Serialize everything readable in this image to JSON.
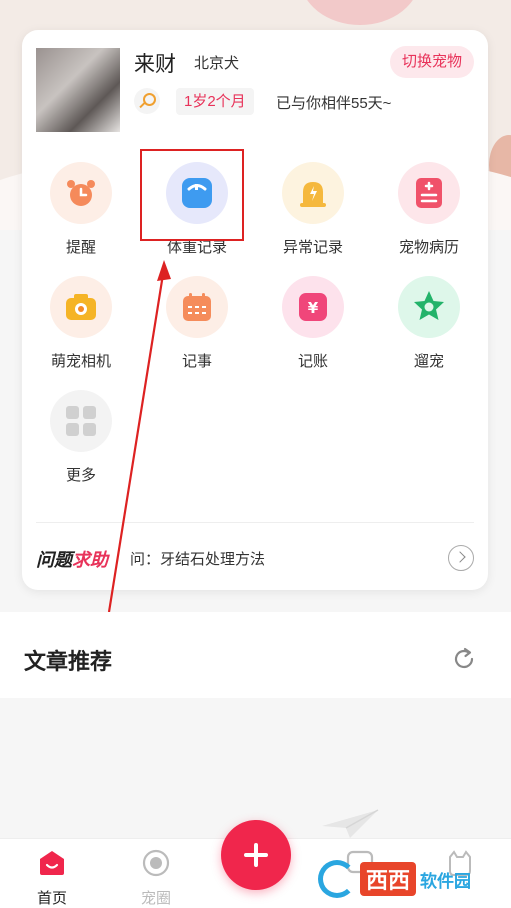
{
  "profile": {
    "name": "来财",
    "breed": "北京犬",
    "switch_label": "切换宠物",
    "age": "1岁2个月",
    "companion": "已与你相伴55天~"
  },
  "features": [
    {
      "label": "提醒",
      "color": "#f58a5b",
      "icon": "alarm-clock-icon"
    },
    {
      "label": "体重记录",
      "color": "#3e9bf0",
      "icon": "scale-icon"
    },
    {
      "label": "异常记录",
      "color": "#f5b83d",
      "icon": "alert-icon"
    },
    {
      "label": "宠物病历",
      "color": "#f0526a",
      "icon": "medical-record-icon"
    },
    {
      "label": "萌宠相机",
      "color": "#f5b426",
      "icon": "camera-icon"
    },
    {
      "label": "记事",
      "color": "#f58c5b",
      "icon": "calendar-icon"
    },
    {
      "label": "记账",
      "color": "#f0467a",
      "icon": "yuan-icon"
    },
    {
      "label": "遛宠",
      "color": "#23b36a",
      "icon": "star-icon"
    },
    {
      "label": "更多",
      "color": "#d0d0d0",
      "icon": "grid-icon"
    }
  ],
  "qa": {
    "title_black": "问题",
    "title_red": "求助",
    "question": "问：牙结石处理方法"
  },
  "articles": {
    "title": "文章推荐"
  },
  "tabbar": {
    "home": "首页",
    "circle": "宠圈"
  },
  "watermark": {
    "brand": "西西",
    "brand2": "软件园"
  },
  "colors": {
    "accent": "#f0264c",
    "highlight_box": "#dd2222"
  }
}
